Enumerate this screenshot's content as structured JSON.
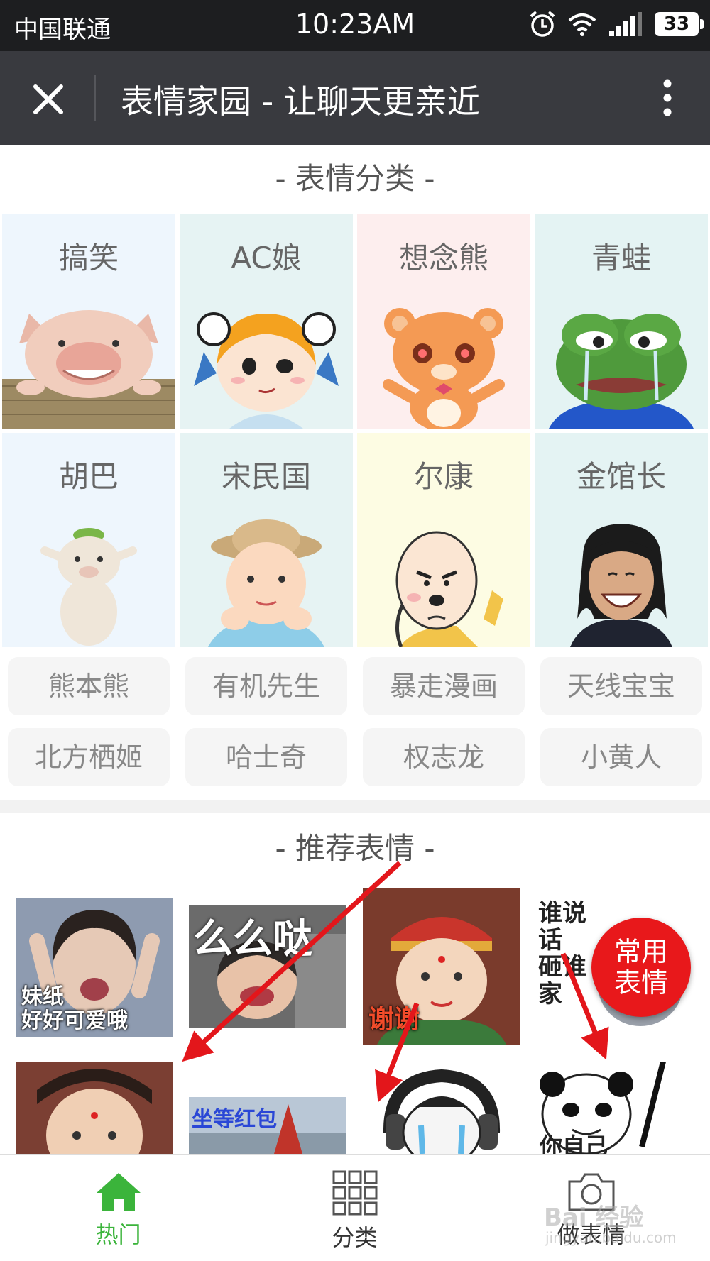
{
  "status_bar": {
    "carrier": "中国联通",
    "time": "10:23AM",
    "battery": "33"
  },
  "title_bar": {
    "title": "表情家园 - 让聊天更亲近"
  },
  "categories_section": {
    "heading": "- 表情分类 -"
  },
  "categories": [
    {
      "name": "搞笑",
      "bg": "#eef6fd"
    },
    {
      "name": "AC娘",
      "bg": "#e6f3f3"
    },
    {
      "name": "想念熊",
      "bg": "#fdeeee"
    },
    {
      "name": "青蛙",
      "bg": "#e4f3f3"
    },
    {
      "name": "胡巴",
      "bg": "#eef6fd"
    },
    {
      "name": "宋民国",
      "bg": "#e6f3f3"
    },
    {
      "name": "尔康",
      "bg": "#fdfce3"
    },
    {
      "name": "金馆长",
      "bg": "#e4f3f3"
    }
  ],
  "tags": [
    "熊本熊",
    "有机先生",
    "暴走漫画",
    "天线宝宝",
    "北方栖姬",
    "哈士奇",
    "权志龙",
    "小黄人"
  ],
  "recommended_section": {
    "heading": "- 推荐表情 -"
  },
  "recommended": [
    {
      "caption": "妹纸\n好好可爱哦"
    },
    {
      "caption": "么么哒"
    },
    {
      "caption": "谢谢"
    },
    {
      "caption": "谁说\n话\n砸谁\n家"
    },
    {
      "caption": ""
    },
    {
      "caption": "坐等红包"
    },
    {
      "caption": ""
    },
    {
      "caption": "你自己"
    }
  ],
  "fab": {
    "line1": "常用",
    "line2": "表情"
  },
  "bottom_nav": [
    {
      "label": "热门",
      "active": true
    },
    {
      "label": "分类",
      "active": false
    },
    {
      "label": "做表情",
      "active": false
    }
  ],
  "watermark": {
    "text": "Bai 经验",
    "sub": "jingyan.baidu.com"
  },
  "colors": {
    "accent_green": "#3bb43b",
    "fab_red": "#e8181b",
    "title_bar": "#393a3f",
    "arrow_red": "#e3161b"
  }
}
